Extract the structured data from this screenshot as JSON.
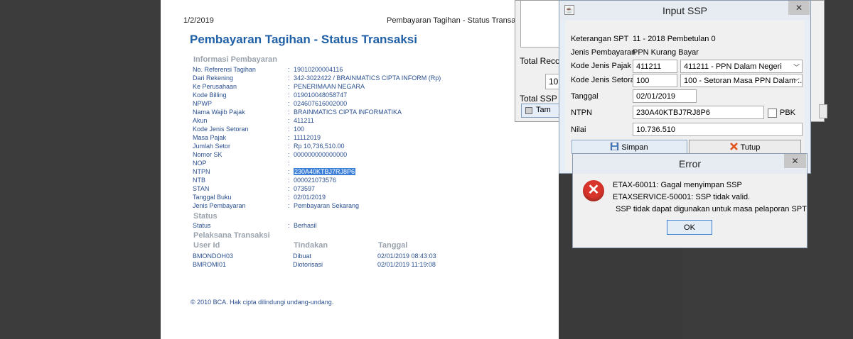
{
  "paper": {
    "top_date": "1/2/2019",
    "top_title": "Pembayaran Tagihan - Status Transaksi",
    "heading": "Pembayaran Tagihan - Status Transaksi",
    "section_info": "Informasi Pembayaran",
    "separator": ":",
    "info_rows": [
      {
        "label": "No. Referensi Tagihan",
        "value": "19010200004116"
      },
      {
        "label": "Dari Rekening",
        "value": "342-3022422 / BRAINMATICS CIPTA INFORM (Rp)"
      },
      {
        "label": "Ke Perusahaan",
        "value": "PENERIMAAN NEGARA"
      },
      {
        "label": "Kode Billing",
        "value": "019010048058747"
      },
      {
        "label": "NPWP",
        "value": "024607616002000"
      },
      {
        "label": "Nama Wajib Pajak",
        "value": "BRAINMATICS CIPTA INFORMATIKA"
      },
      {
        "label": "Akun",
        "value": "411211"
      },
      {
        "label": "Kode Jenis Setoran",
        "value": "100"
      },
      {
        "label": "Masa Pajak",
        "value": "11112019"
      },
      {
        "label": "Jumlah Setor",
        "value": "Rp 10,736,510.00"
      },
      {
        "label": "Nomor SK",
        "value": "000000000000000"
      },
      {
        "label": "NOP",
        "value": ""
      },
      {
        "label": "NTPN",
        "value": "230A40KTBJ7RJ8P6"
      },
      {
        "label": "NTB",
        "value": "000021073576"
      },
      {
        "label": "STAN",
        "value": "073597"
      },
      {
        "label": "Tanggal Buku",
        "value": "02/01/2019"
      },
      {
        "label": "Jenis Pembayaran",
        "value": "Pembayaran Sekarang"
      }
    ],
    "section_status": "Status",
    "status_row": {
      "label": "Status",
      "value": "Berhasil"
    },
    "section_pelaksana": "Pelaksana Transaksi",
    "table_headers": [
      "User Id",
      "Tindakan",
      "Tanggal"
    ],
    "table_rows": [
      [
        "BMONDOH03",
        "Dibuat",
        "02/01/2019 08:43:03"
      ],
      [
        "BMROMI01",
        "Diotorisasi",
        "02/01/2019 11:19:08"
      ]
    ],
    "footer": "©  2010 BCA. Hak cipta dilindungi undang-undang."
  },
  "background_window": {
    "total_records_label": "Total Recor",
    "box_value": "10",
    "total_ssp_label": "Total SSP",
    "button_label": "Tam"
  },
  "input_ssp": {
    "title": "Input SSP",
    "close_glyph": "✕",
    "keterangan_label": "Keterangan SPT",
    "keterangan_value": "11 - 2018 Pembetulan 0",
    "jenis_label": "Jenis Pembayaran",
    "jenis_value": "PPN Kurang Bayar",
    "kode_pajak_label": "Kode Jenis Pajak",
    "kode_pajak_value": "411211",
    "kode_pajak_select": "411211 - PPN Dalam Negeri",
    "kode_setoran_label": "Kode Jenis Setoran",
    "kode_setoran_value": "100",
    "kode_setoran_select": "100 - Setoran Masa PPN Dalam ...",
    "tanggal_label": "Tanggal",
    "tanggal_value": "02/01/2019",
    "ntpn_label": "NTPN",
    "ntpn_value": "230A40KTBJ7RJ8P6",
    "pbk_label": "PBK",
    "nilai_label": "Nilai",
    "nilai_value": "10.736.510",
    "simpan_label": "Simpan",
    "tutup_label": "Tutup"
  },
  "error_dialog": {
    "title": "Error",
    "close_glyph": "✕",
    "icon_glyph": "✕",
    "line1": "ETAX-60011: Gagal menyimpan SSP",
    "line2": "ETAXSERVICE-50001: SSP tidak valid.",
    "line3": "SSP tidak dapat digunakan untuk masa pelaporan SPT",
    "ok_label": "OK"
  },
  "colors": {
    "link_blue": "#2a4f8f",
    "heading_blue": "#1f5fa6",
    "section_gray": "#9aa3ad",
    "highlight": "#3b7fd9",
    "error_red": "#d9342b"
  }
}
